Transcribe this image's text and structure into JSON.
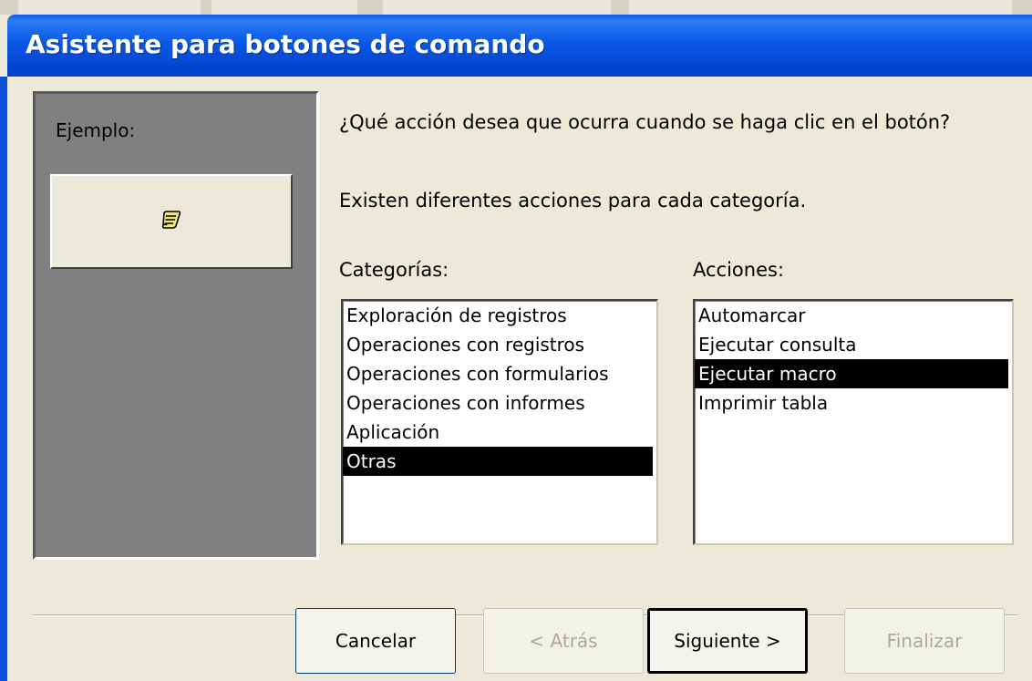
{
  "window": {
    "title": "Asistente para botones de comando"
  },
  "sample": {
    "label": "Ejemplo:",
    "icon": "scroll-icon"
  },
  "question": "¿Qué acción desea que ocurra cuando se haga clic en el botón?",
  "info": "Existen diferentes acciones para cada categoría.",
  "categories": {
    "label": "Categorías:",
    "items": [
      "Exploración de registros",
      "Operaciones con registros",
      "Operaciones con formularios",
      "Operaciones con informes",
      "Aplicación",
      "Otras"
    ],
    "selected": "Otras"
  },
  "actions": {
    "label": "Acciones:",
    "items": [
      "Automarcar",
      "Ejecutar consulta",
      "Ejecutar macro",
      "Imprimir tabla"
    ],
    "selected": "Ejecutar macro"
  },
  "buttons": {
    "cancel": "Cancelar",
    "back": "< Atrás",
    "next": "Siguiente >",
    "finish": "Finalizar"
  },
  "colors": {
    "titlebar": "#0a58e6",
    "selection": "#000000",
    "dialog_bg": "#ece9d8",
    "sample_bg": "#808080"
  }
}
